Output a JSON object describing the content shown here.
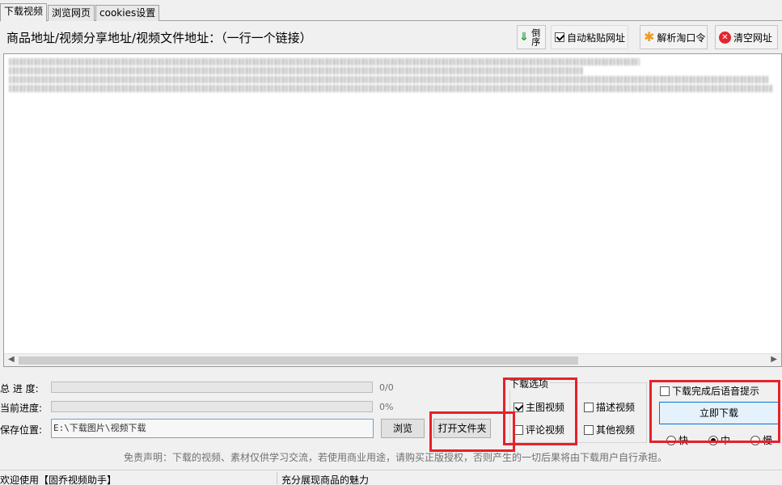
{
  "tabs": [
    {
      "label": "下载视频",
      "active": true
    },
    {
      "label": "浏览网页",
      "active": false
    },
    {
      "label": "cookies设置",
      "active": false
    }
  ],
  "heading": "商品地址/视频分享地址/视频文件地址：（一行一个链接）",
  "toolbar": {
    "reverse_label": "倒序",
    "auto_paste_label": "自动粘贴网址",
    "auto_paste_checked": true,
    "parse_label": "解析淘口令",
    "clear_label": "清空网址"
  },
  "progress": {
    "total_label": "总 进 度:",
    "total_value": "0/0",
    "total_fraction": 0,
    "current_label": "当前进度:",
    "current_value": "0%",
    "current_fraction": 0
  },
  "save": {
    "label": "保存位置:",
    "path": "E:\\下载图片\\视频下载",
    "browse_label": "浏览",
    "open_folder_label": "打开文件夹"
  },
  "download_options": {
    "legend": "下载选项",
    "main_video": {
      "label": "主图视频",
      "checked": true
    },
    "desc_video": {
      "label": "描述视频",
      "checked": false
    },
    "comment_video": {
      "label": "评论视频",
      "checked": false
    },
    "other_video": {
      "label": "其他视频",
      "checked": false
    }
  },
  "voice_prompt": {
    "label": "下载完成后语音提示",
    "checked": false
  },
  "download_now_label": "立即下载",
  "speed": {
    "fast": "快",
    "medium": "中",
    "slow": "慢",
    "selected": "medium"
  },
  "disclaimer": "免责声明：下载的视频、素材仅供学习交流，若使用商业用途，请购买正版授权，否则产生的一切后果将由下载用户自行承担。",
  "status": {
    "left": "欢迎使用【固乔视频助手】",
    "right": "充分展现商品的魅力"
  },
  "colors": {
    "highlight": "#e8202a",
    "progress": "#06b025"
  }
}
